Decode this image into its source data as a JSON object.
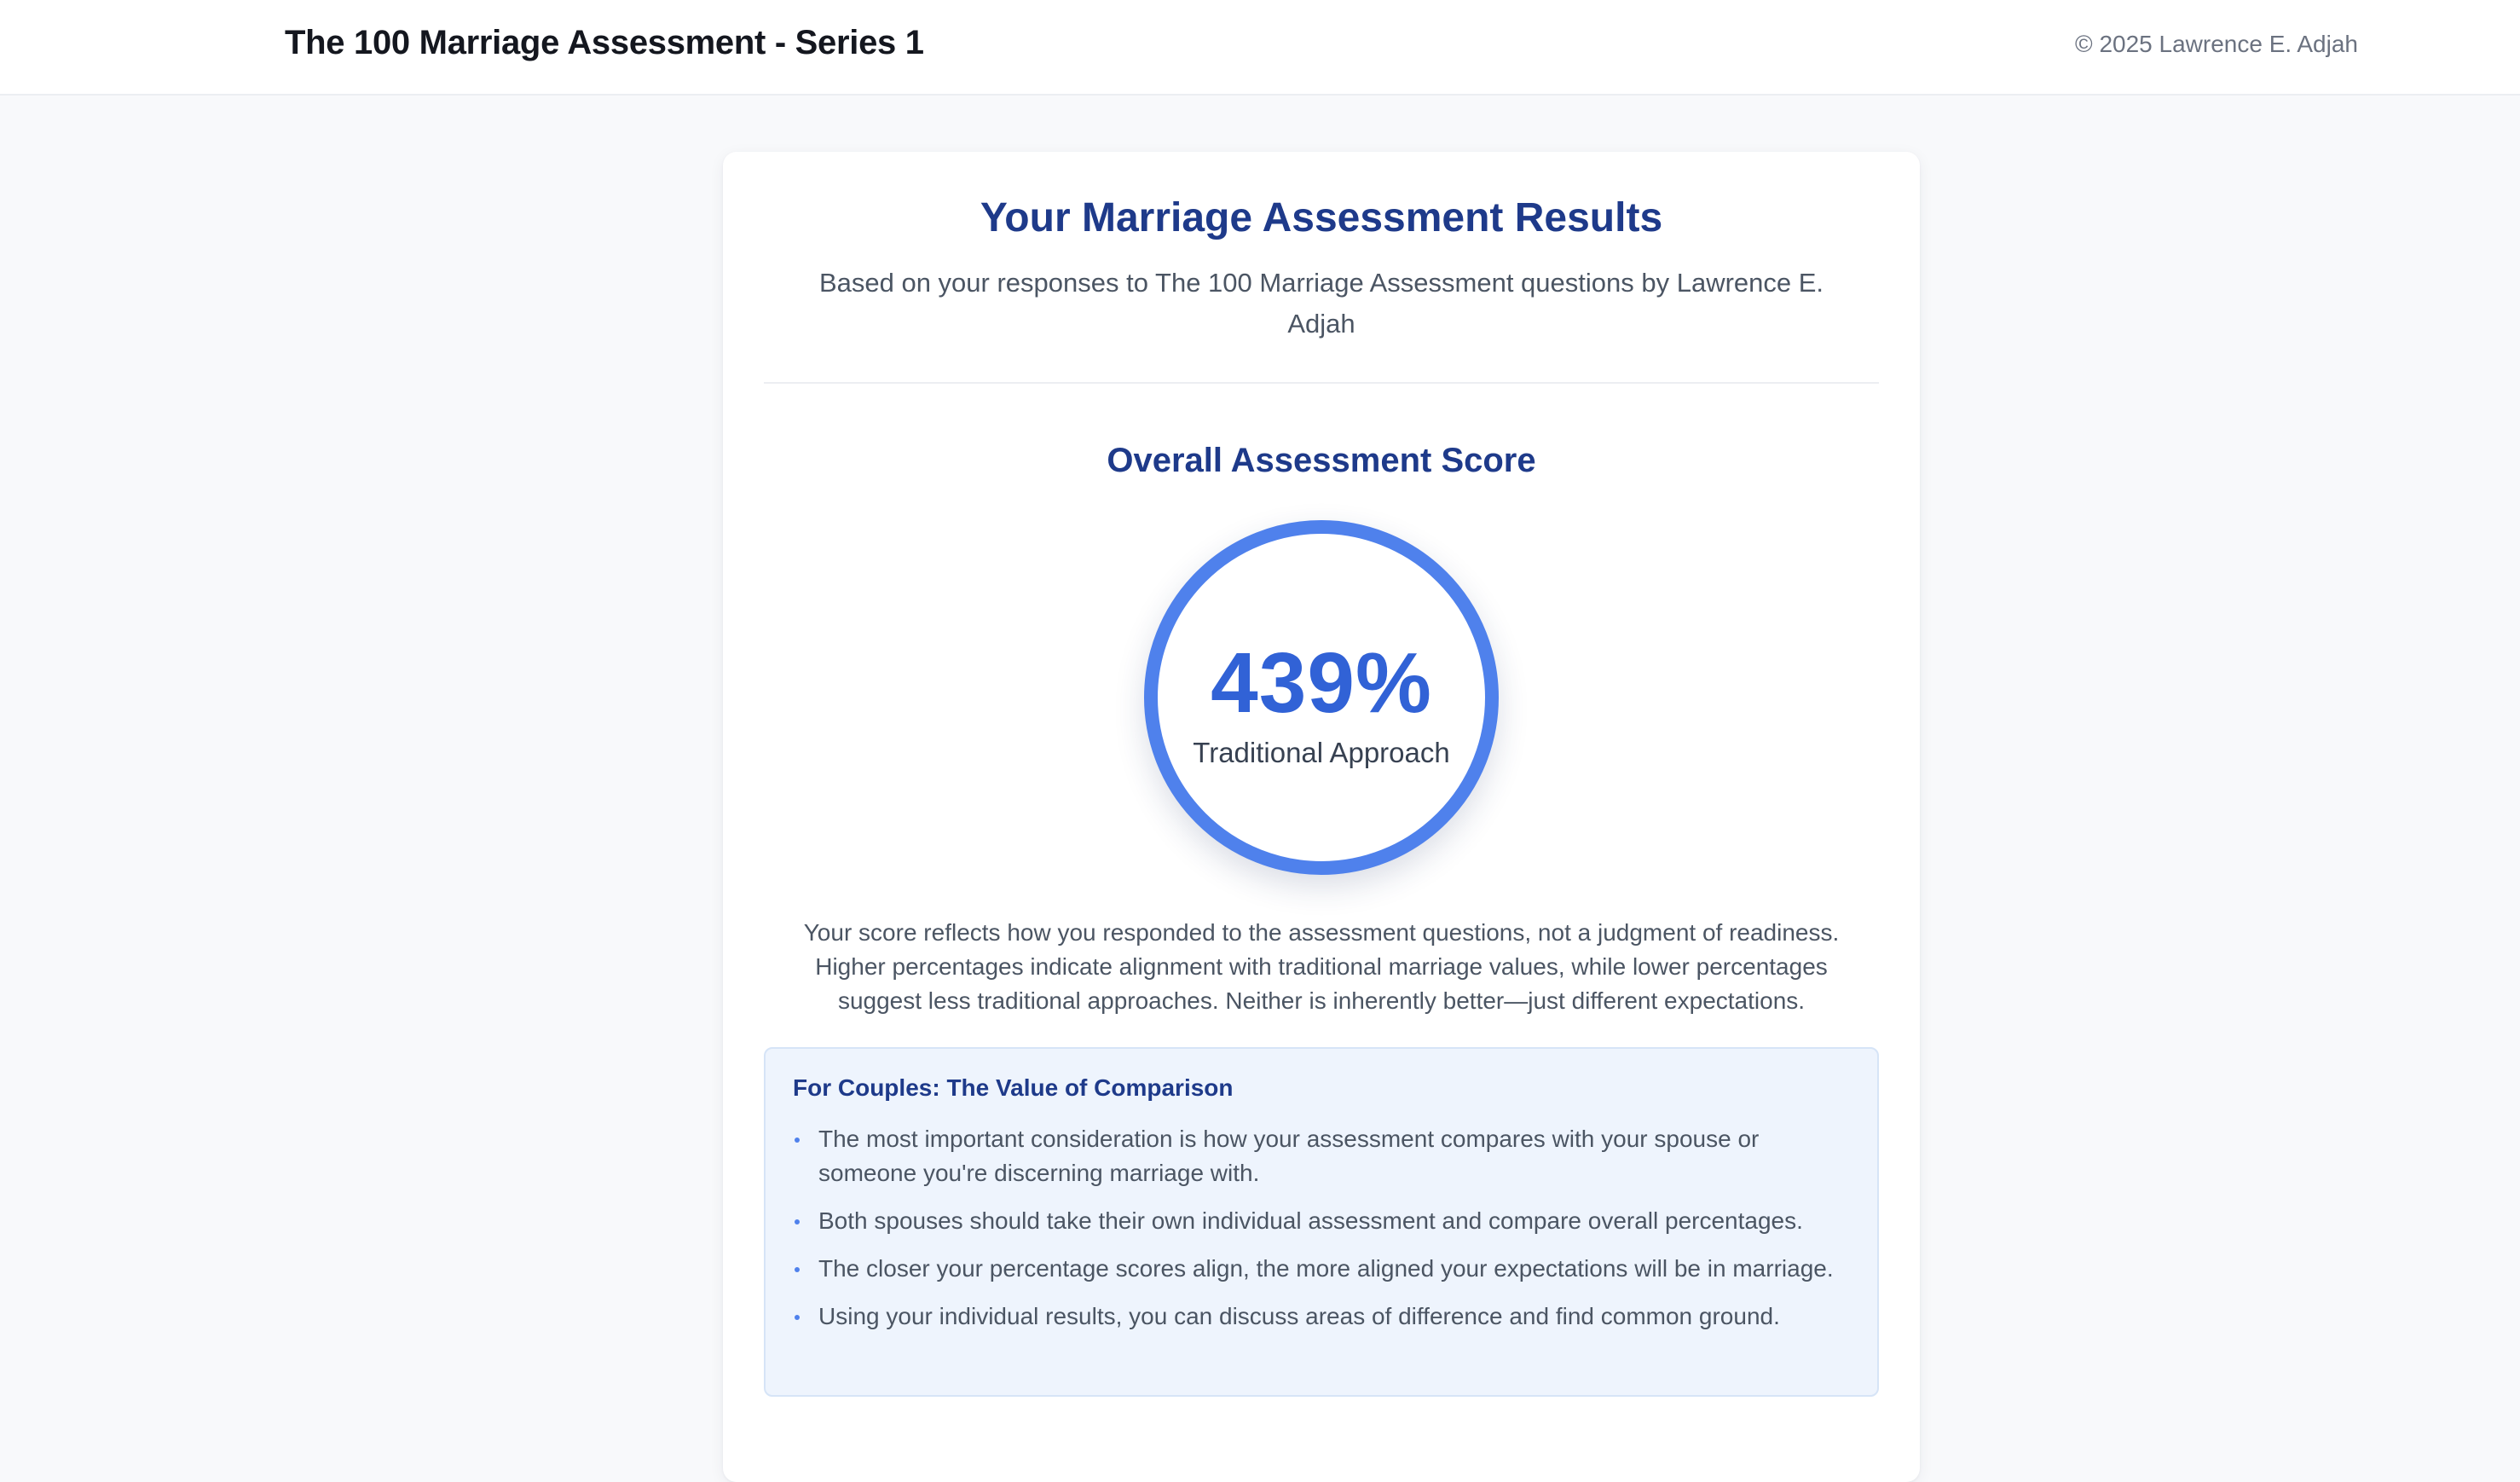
{
  "header": {
    "title": "The 100 Marriage Assessment - Series 1",
    "copyright": "© 2025 Lawrence E. Adjah"
  },
  "results": {
    "title": "Your Marriage Assessment Results",
    "subtitle": "Based on your responses to The 100 Marriage Assessment questions by Lawrence E. Adjah"
  },
  "score": {
    "heading": "Overall Assessment Score",
    "value": "439%",
    "label": "Traditional Approach",
    "explanation": "Your score reflects how you responded to the assessment questions, not a judgment of readiness. Higher percentages indicate alignment with traditional marriage values, while lower percentages suggest less traditional approaches. Neither is inherently better—just different expectations."
  },
  "couples": {
    "title": "For Couples: The Value of Comparison",
    "items": [
      "The most important consideration is how your assessment compares with your spouse or someone you're discerning marriage with.",
      "Both spouses should take their own individual assessment and compare overall percentages.",
      "The closer your percentage scores align, the more aligned your expectations will be in marriage.",
      "Using your individual results, you can discuss areas of difference and find common ground."
    ]
  },
  "colors": {
    "accent": "#4f81ec",
    "heading": "#1e3a8a",
    "score_text": "#3162d6",
    "callout_bg": "#eef4fd"
  }
}
